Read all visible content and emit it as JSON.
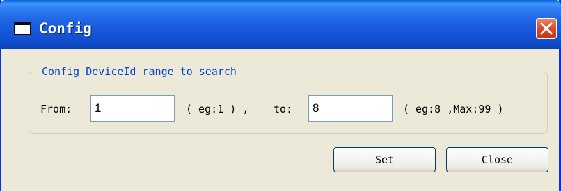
{
  "window": {
    "title": "Config"
  },
  "group": {
    "title": "Config DeviceId range to search"
  },
  "form": {
    "from_label": "From:",
    "from_value": "1",
    "from_hint": "( eg:1 ) ,",
    "to_label": "to:",
    "to_value": "8",
    "to_hint": "( eg:8 ,Max:99 )"
  },
  "buttons": {
    "set_label": "Set",
    "close_label": "Close"
  },
  "icons": {
    "title_icon": "window-icon",
    "close_icon": "close-x-icon"
  },
  "colors": {
    "titlebar_blue": "#1d62e3",
    "close_red": "#d8512e",
    "group_title_blue": "#0046d5",
    "dialog_bg": "#ece9d8"
  }
}
